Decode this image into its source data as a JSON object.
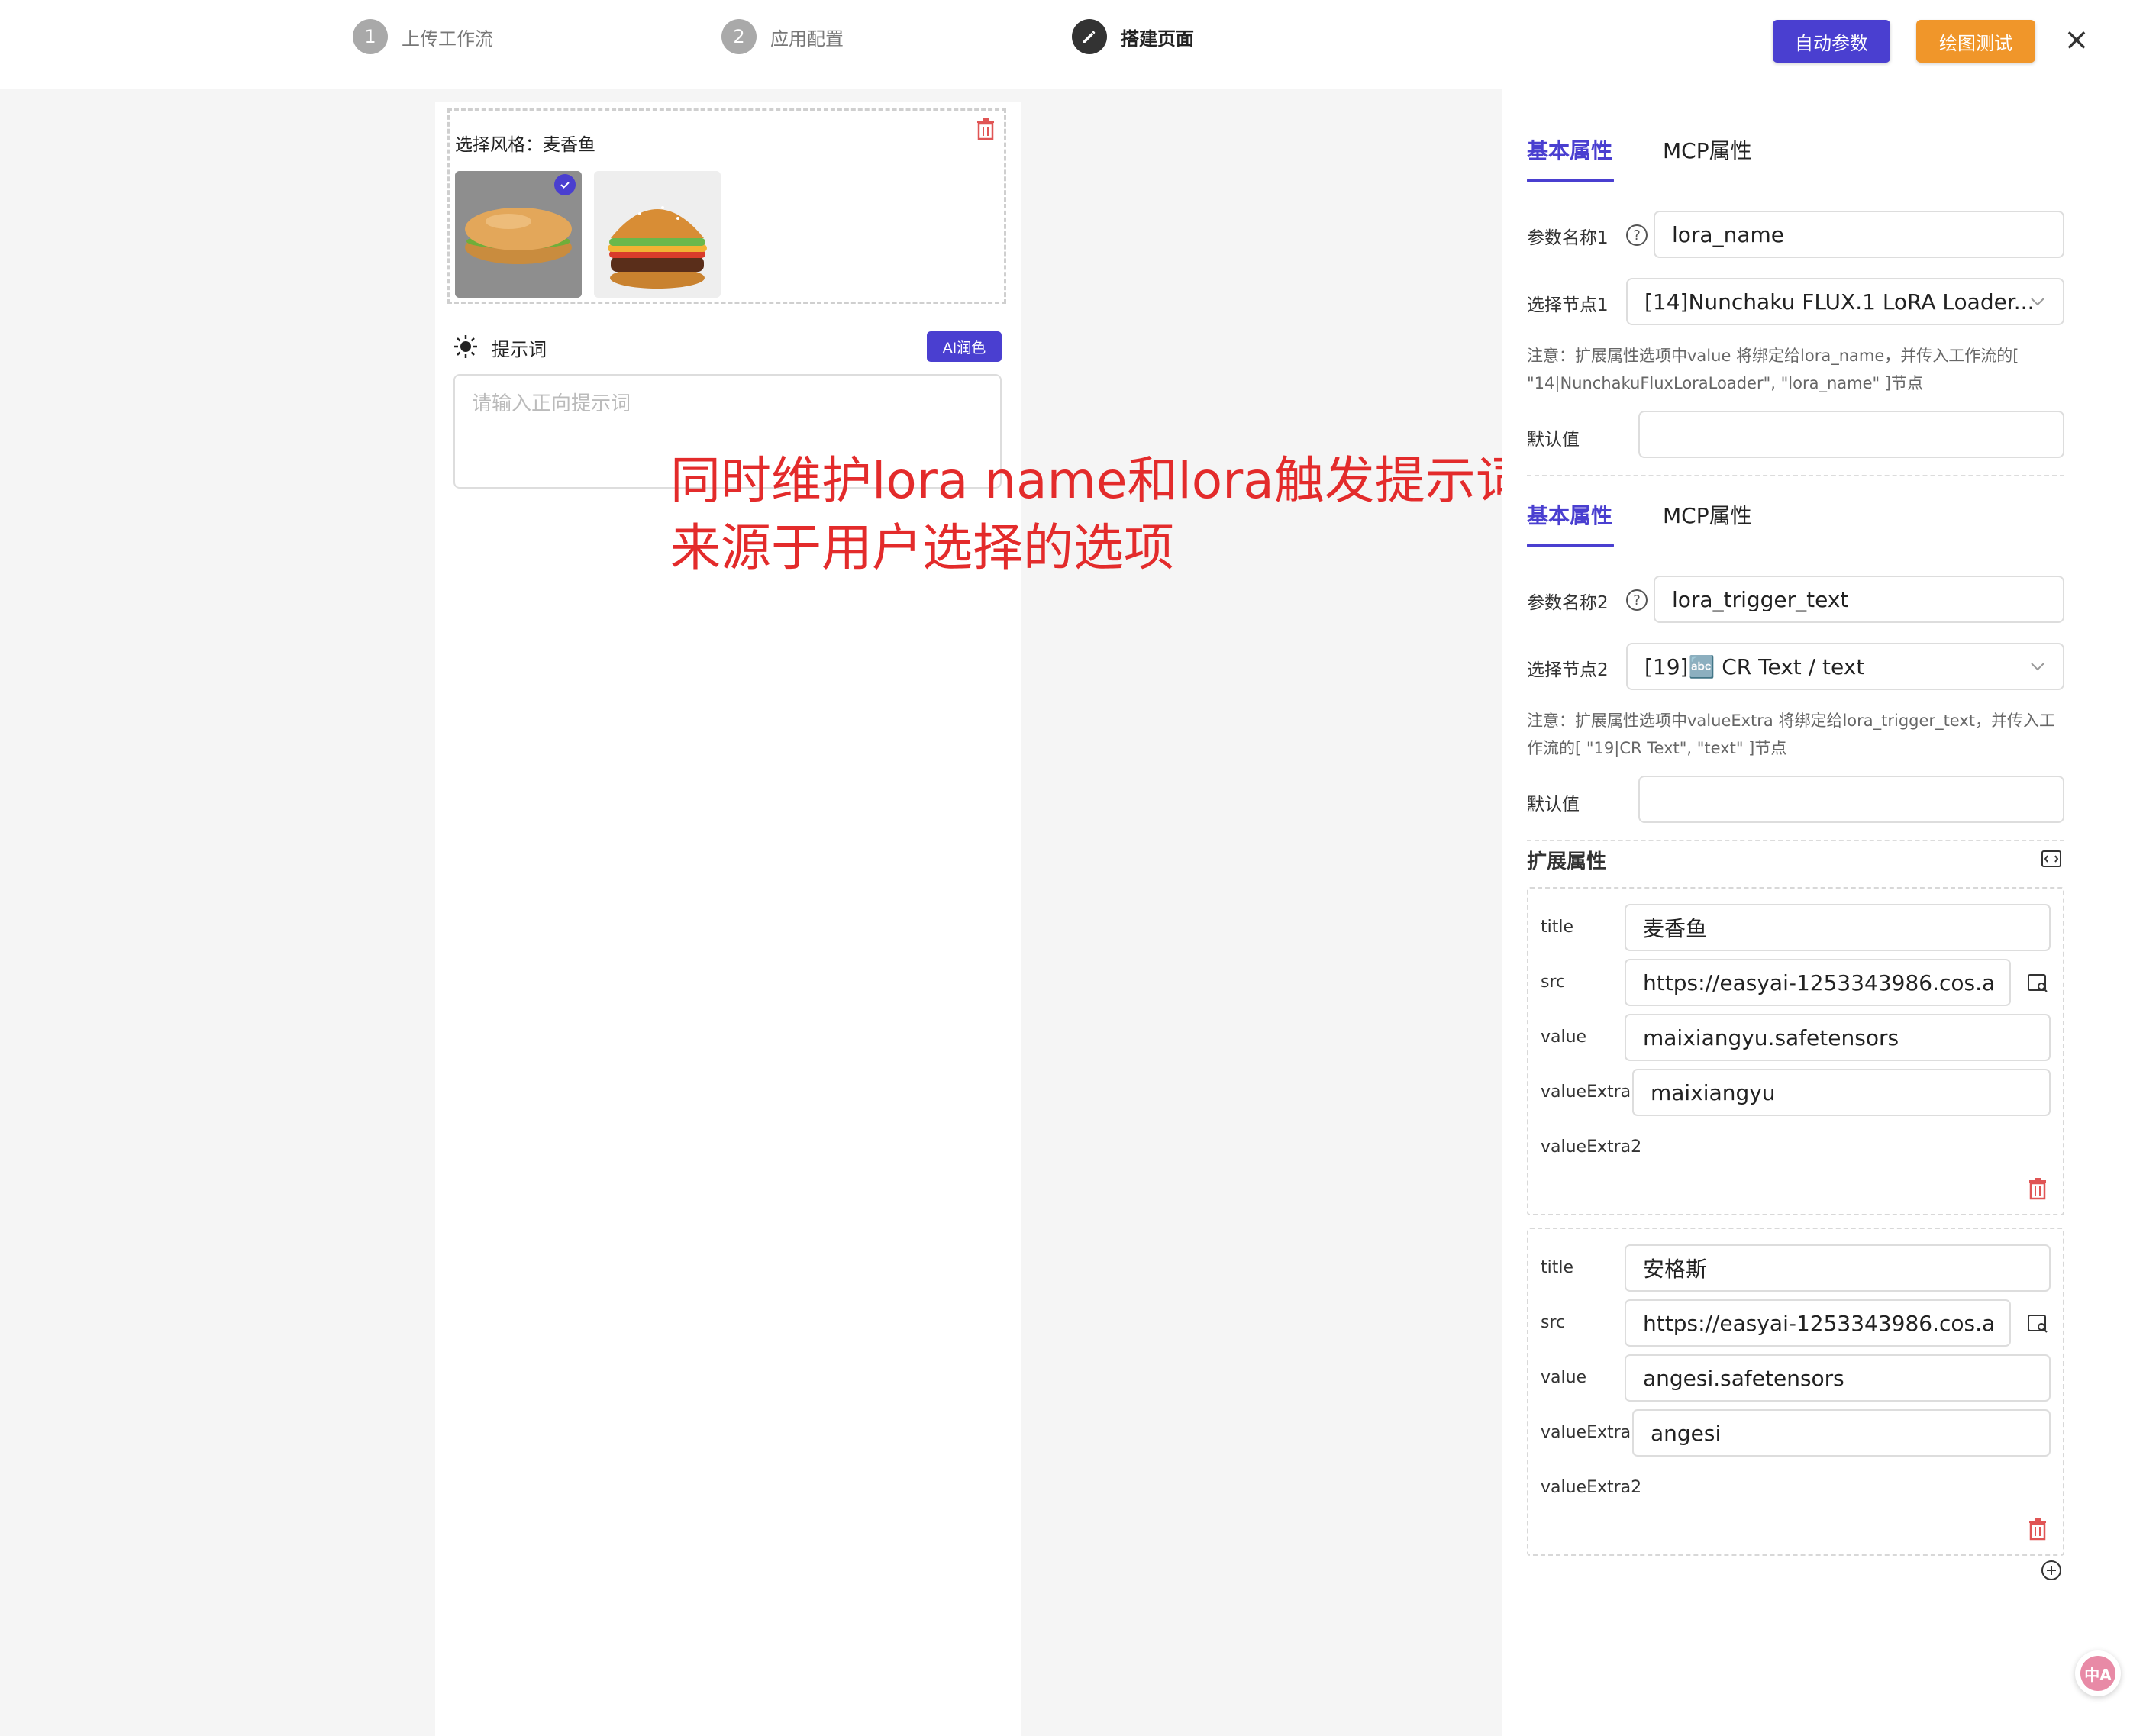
{
  "steps": [
    {
      "num": "1",
      "label": "上传工作流"
    },
    {
      "num": "2",
      "label": "应用配置"
    },
    {
      "num": "",
      "label": "搭建页面"
    }
  ],
  "header": {
    "auto_params": "自动参数",
    "draw_test": "绘图测试",
    "close": "×",
    "colors": {
      "primary": "#4a3fd0",
      "orange": "#f0962a"
    }
  },
  "preview": {
    "style_title": "选择风格：麦香鱼",
    "thumbnails": [
      "sandwich-image",
      "burger-image"
    ],
    "prompt_label": "提示词",
    "ai_button": "AI润色",
    "prompt_placeholder": "请输入正向提示词"
  },
  "annotation": "同时维护lora name和lora触发提示词，参数来源于用户选择的选项",
  "panel": {
    "block1": {
      "tab_basic": "基本属性",
      "tab_mcp": "MCP属性",
      "param_label": "参数名称1",
      "param_value": "lora_name",
      "node_label": "选择节点1",
      "node_value": "[14]Nunchaku FLUX.1 LoRA Loader...",
      "note": "注意：扩展属性选项中value 将绑定给lora_name，并传入工作流的[ \"14|NunchakuFluxLoraLoader\", \"lora_name\" ]节点",
      "default_label": "默认值",
      "default_value": ""
    },
    "block2": {
      "tab_basic": "基本属性",
      "tab_mcp": "MCP属性",
      "param_label": "参数名称2",
      "param_value": "lora_trigger_text",
      "node_label": "选择节点2",
      "node_value": "[19]🔤 CR Text / text",
      "note": "注意：扩展属性选项中valueExtra 将绑定给lora_trigger_text，并传入工作流的[ \"19|CR Text\", \"text\" ]节点",
      "default_label": "默认值",
      "default_value": ""
    },
    "ext_title": "扩展属性",
    "ext_items": [
      {
        "title_label": "title",
        "title": "麦香鱼",
        "src_label": "src",
        "src": "https://easyai-1253343986.cos.a",
        "value_label": "value",
        "value": "maixiangyu.safetensors",
        "extra_label": "valueExtra",
        "extra": "maixiangyu",
        "extra2_label": "valueExtra2"
      },
      {
        "title_label": "title",
        "title": "安格斯",
        "src_label": "src",
        "src": "https://easyai-1253343986.cos.a",
        "value_label": "value",
        "value": "angesi.safetensors",
        "extra_label": "valueExtra",
        "extra": "angesi",
        "extra2_label": "valueExtra2"
      }
    ]
  },
  "floating": {
    "label": "中A"
  }
}
